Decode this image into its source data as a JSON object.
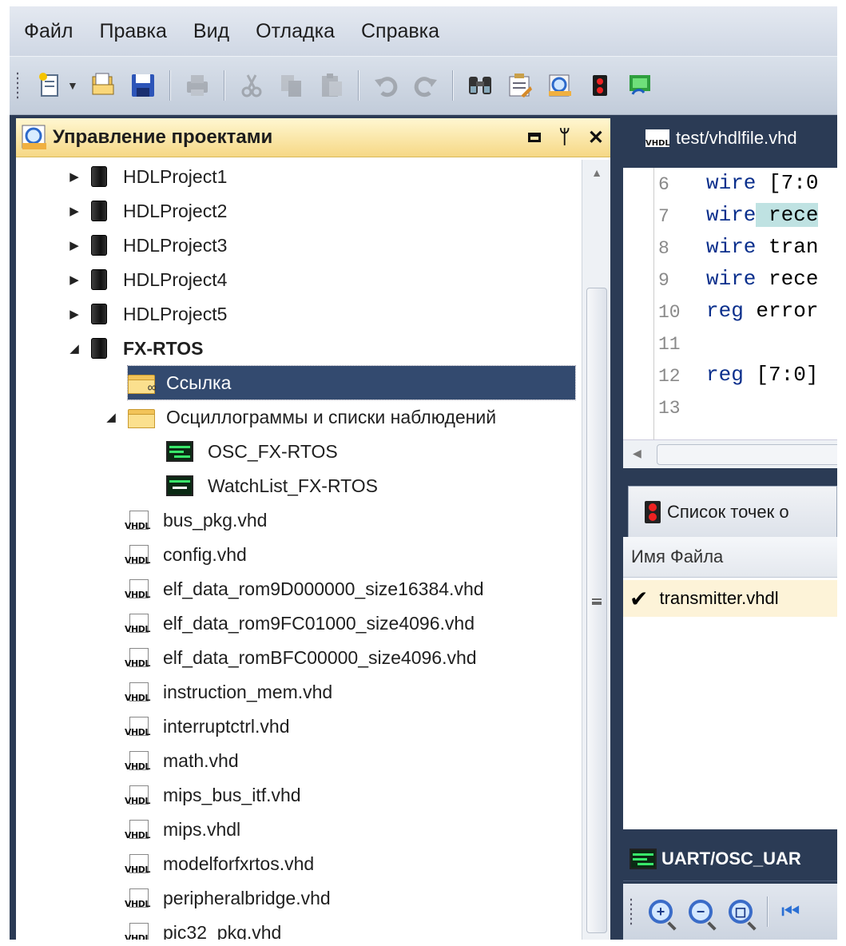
{
  "menu": [
    "Файл",
    "Правка",
    "Вид",
    "Отладка",
    "Справка"
  ],
  "toolbar": {
    "icons": [
      "new-file-icon",
      "open-project-icon",
      "save-icon",
      "print-icon",
      "cut-icon",
      "copy-icon",
      "paste-icon",
      "undo-icon",
      "redo-icon",
      "find-icon",
      "properties-icon",
      "search-view-icon",
      "breakpoint-icon",
      "run-icon"
    ]
  },
  "project_panel": {
    "title": "Управление проектами",
    "projects": [
      "HDLProject1",
      "HDLProject2",
      "HDLProject3",
      "HDLProject4",
      "HDLProject5"
    ],
    "active_project": "FX-RTOS",
    "link_folder": "Ссылка",
    "osc_folder": "Осциллограммы и списки наблюдений",
    "osc_items": [
      "OSC_FX-RTOS",
      "WatchList_FX-RTOS"
    ],
    "files": [
      "bus_pkg.vhd",
      "config.vhd",
      "elf_data_rom9D000000_size16384.vhd",
      "elf_data_rom9FC01000_size4096.vhd",
      "elf_data_romBFC00000_size4096.vhd",
      "instruction_mem.vhd",
      "interruptctrl.vhd",
      "math.vhd",
      "mips_bus_itf.vhd",
      "mips.vhdl",
      "modelforfxrtos.vhd",
      "peripheralbridge.vhd",
      "pic32_pkg.vhd"
    ],
    "file_icon_text": "VHDL"
  },
  "editor": {
    "tab": "test/vhdlfile.vhd",
    "lines": [
      {
        "n": "6",
        "kw": "wire",
        "rest": " [7:0"
      },
      {
        "n": "7",
        "kw": "wire",
        "rest": " rece",
        "hl": true
      },
      {
        "n": "8",
        "kw": "wire",
        "rest": " tran"
      },
      {
        "n": "9",
        "kw": "wire",
        "rest": " rece"
      },
      {
        "n": "10",
        "kw": "reg",
        "rest": " error"
      },
      {
        "n": "11",
        "kw": "",
        "rest": ""
      },
      {
        "n": "12",
        "kw": "reg",
        "rest": " [7:0]"
      },
      {
        "n": "13",
        "kw": "",
        "rest": ""
      }
    ]
  },
  "breakpoints": {
    "tab": "Список точек о",
    "column": "Имя Файла",
    "row": "transmitter.vhdl"
  },
  "osc": {
    "title": "UART/OSC_UAR"
  }
}
